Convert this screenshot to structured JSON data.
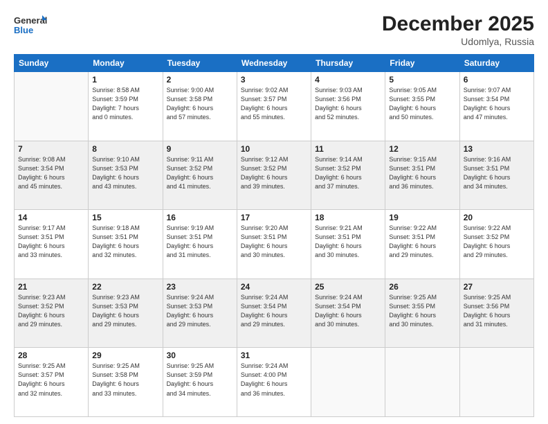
{
  "header": {
    "logo_line1": "General",
    "logo_line2": "Blue",
    "month": "December 2025",
    "location": "Udomlya, Russia"
  },
  "weekdays": [
    "Sunday",
    "Monday",
    "Tuesday",
    "Wednesday",
    "Thursday",
    "Friday",
    "Saturday"
  ],
  "weeks": [
    [
      {
        "day": "",
        "info": ""
      },
      {
        "day": "1",
        "info": "Sunrise: 8:58 AM\nSunset: 3:59 PM\nDaylight: 7 hours\nand 0 minutes."
      },
      {
        "day": "2",
        "info": "Sunrise: 9:00 AM\nSunset: 3:58 PM\nDaylight: 6 hours\nand 57 minutes."
      },
      {
        "day": "3",
        "info": "Sunrise: 9:02 AM\nSunset: 3:57 PM\nDaylight: 6 hours\nand 55 minutes."
      },
      {
        "day": "4",
        "info": "Sunrise: 9:03 AM\nSunset: 3:56 PM\nDaylight: 6 hours\nand 52 minutes."
      },
      {
        "day": "5",
        "info": "Sunrise: 9:05 AM\nSunset: 3:55 PM\nDaylight: 6 hours\nand 50 minutes."
      },
      {
        "day": "6",
        "info": "Sunrise: 9:07 AM\nSunset: 3:54 PM\nDaylight: 6 hours\nand 47 minutes."
      }
    ],
    [
      {
        "day": "7",
        "info": "Sunrise: 9:08 AM\nSunset: 3:54 PM\nDaylight: 6 hours\nand 45 minutes."
      },
      {
        "day": "8",
        "info": "Sunrise: 9:10 AM\nSunset: 3:53 PM\nDaylight: 6 hours\nand 43 minutes."
      },
      {
        "day": "9",
        "info": "Sunrise: 9:11 AM\nSunset: 3:52 PM\nDaylight: 6 hours\nand 41 minutes."
      },
      {
        "day": "10",
        "info": "Sunrise: 9:12 AM\nSunset: 3:52 PM\nDaylight: 6 hours\nand 39 minutes."
      },
      {
        "day": "11",
        "info": "Sunrise: 9:14 AM\nSunset: 3:52 PM\nDaylight: 6 hours\nand 37 minutes."
      },
      {
        "day": "12",
        "info": "Sunrise: 9:15 AM\nSunset: 3:51 PM\nDaylight: 6 hours\nand 36 minutes."
      },
      {
        "day": "13",
        "info": "Sunrise: 9:16 AM\nSunset: 3:51 PM\nDaylight: 6 hours\nand 34 minutes."
      }
    ],
    [
      {
        "day": "14",
        "info": "Sunrise: 9:17 AM\nSunset: 3:51 PM\nDaylight: 6 hours\nand 33 minutes."
      },
      {
        "day": "15",
        "info": "Sunrise: 9:18 AM\nSunset: 3:51 PM\nDaylight: 6 hours\nand 32 minutes."
      },
      {
        "day": "16",
        "info": "Sunrise: 9:19 AM\nSunset: 3:51 PM\nDaylight: 6 hours\nand 31 minutes."
      },
      {
        "day": "17",
        "info": "Sunrise: 9:20 AM\nSunset: 3:51 PM\nDaylight: 6 hours\nand 30 minutes."
      },
      {
        "day": "18",
        "info": "Sunrise: 9:21 AM\nSunset: 3:51 PM\nDaylight: 6 hours\nand 30 minutes."
      },
      {
        "day": "19",
        "info": "Sunrise: 9:22 AM\nSunset: 3:51 PM\nDaylight: 6 hours\nand 29 minutes."
      },
      {
        "day": "20",
        "info": "Sunrise: 9:22 AM\nSunset: 3:52 PM\nDaylight: 6 hours\nand 29 minutes."
      }
    ],
    [
      {
        "day": "21",
        "info": "Sunrise: 9:23 AM\nSunset: 3:52 PM\nDaylight: 6 hours\nand 29 minutes."
      },
      {
        "day": "22",
        "info": "Sunrise: 9:23 AM\nSunset: 3:53 PM\nDaylight: 6 hours\nand 29 minutes."
      },
      {
        "day": "23",
        "info": "Sunrise: 9:24 AM\nSunset: 3:53 PM\nDaylight: 6 hours\nand 29 minutes."
      },
      {
        "day": "24",
        "info": "Sunrise: 9:24 AM\nSunset: 3:54 PM\nDaylight: 6 hours\nand 29 minutes."
      },
      {
        "day": "25",
        "info": "Sunrise: 9:24 AM\nSunset: 3:54 PM\nDaylight: 6 hours\nand 30 minutes."
      },
      {
        "day": "26",
        "info": "Sunrise: 9:25 AM\nSunset: 3:55 PM\nDaylight: 6 hours\nand 30 minutes."
      },
      {
        "day": "27",
        "info": "Sunrise: 9:25 AM\nSunset: 3:56 PM\nDaylight: 6 hours\nand 31 minutes."
      }
    ],
    [
      {
        "day": "28",
        "info": "Sunrise: 9:25 AM\nSunset: 3:57 PM\nDaylight: 6 hours\nand 32 minutes."
      },
      {
        "day": "29",
        "info": "Sunrise: 9:25 AM\nSunset: 3:58 PM\nDaylight: 6 hours\nand 33 minutes."
      },
      {
        "day": "30",
        "info": "Sunrise: 9:25 AM\nSunset: 3:59 PM\nDaylight: 6 hours\nand 34 minutes."
      },
      {
        "day": "31",
        "info": "Sunrise: 9:24 AM\nSunset: 4:00 PM\nDaylight: 6 hours\nand 36 minutes."
      },
      {
        "day": "",
        "info": ""
      },
      {
        "day": "",
        "info": ""
      },
      {
        "day": "",
        "info": ""
      }
    ]
  ]
}
